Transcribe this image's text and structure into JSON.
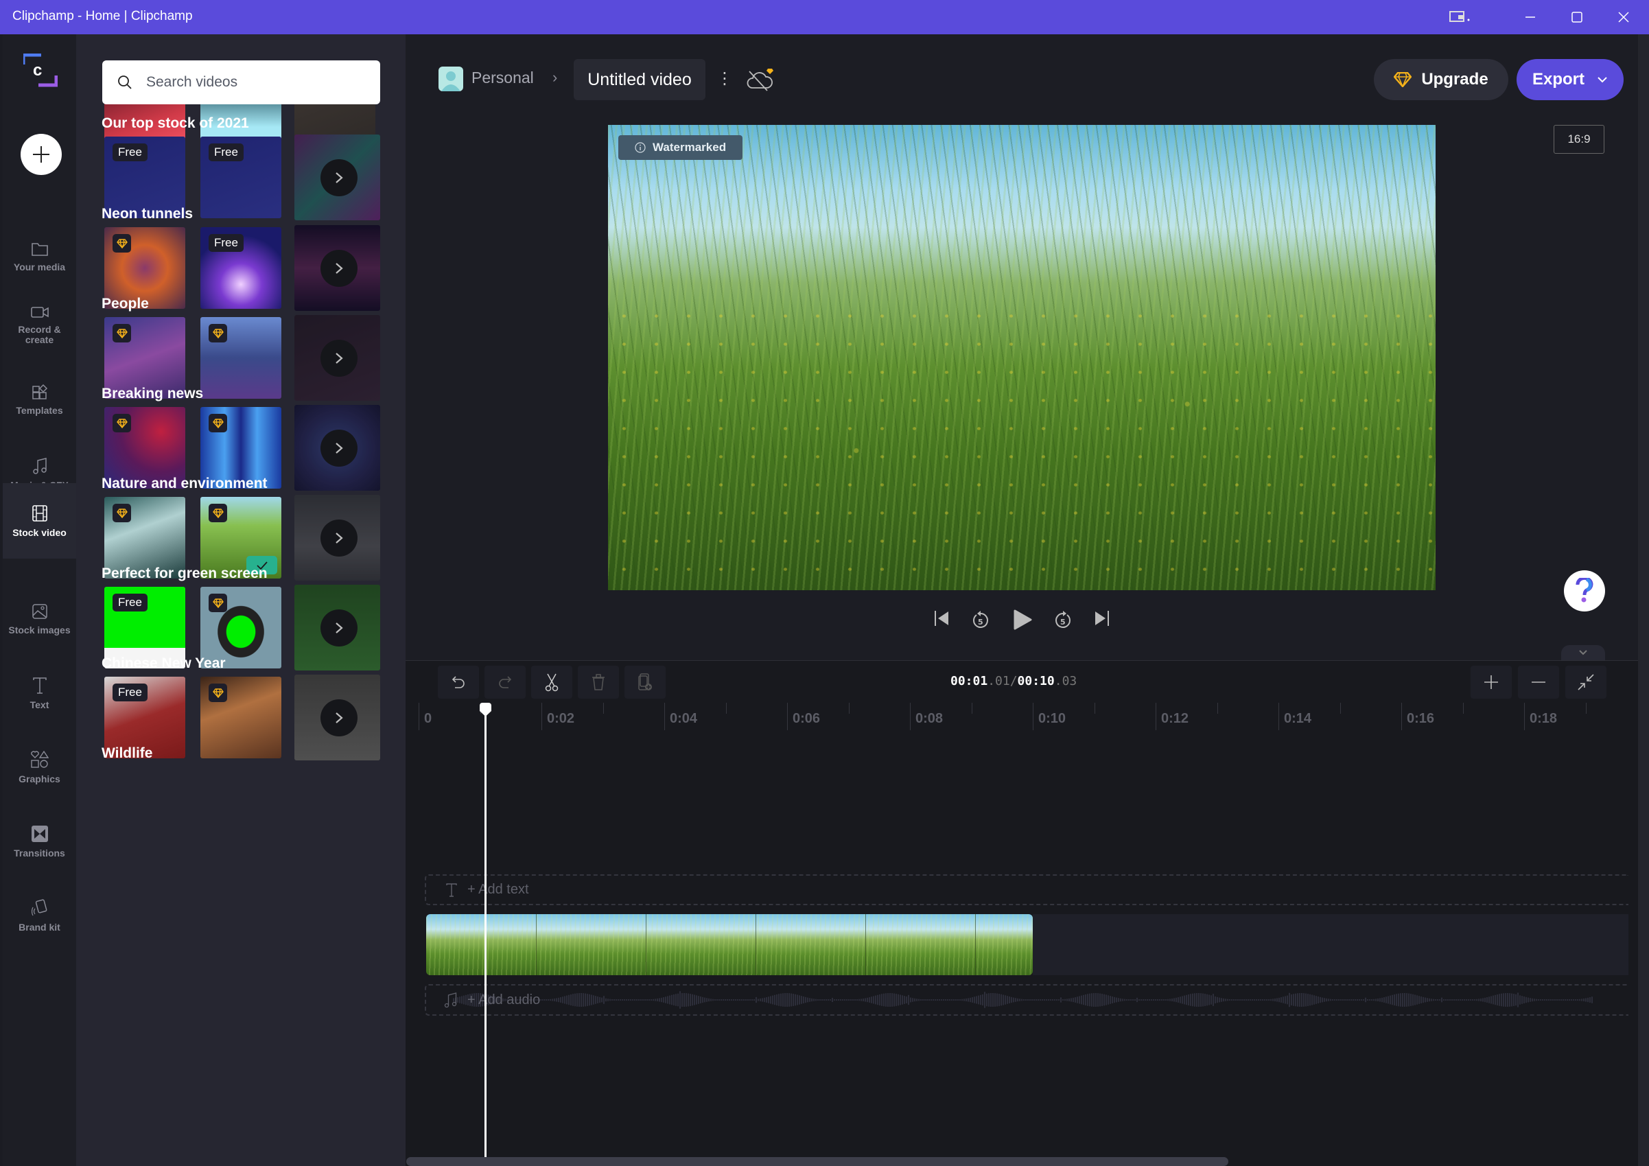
{
  "window": {
    "title": "Clipchamp - Home | Clipchamp",
    "controls": [
      "minimize",
      "maximize",
      "close"
    ]
  },
  "nav": {
    "items": [
      {
        "label": "Your media",
        "icon": "folder-icon"
      },
      {
        "label": "Record & create",
        "icon": "camera-icon"
      },
      {
        "label": "Templates",
        "icon": "templates-icon"
      },
      {
        "label": "Music & SFX",
        "icon": "music-icon"
      },
      {
        "label": "Stock video",
        "icon": "film-icon",
        "active": true
      },
      {
        "label": "Stock images",
        "icon": "image-icon"
      },
      {
        "label": "Text",
        "icon": "text-icon"
      },
      {
        "label": "Graphics",
        "icon": "shapes-icon"
      },
      {
        "label": "Transitions",
        "icon": "transitions-icon"
      },
      {
        "label": "Brand kit",
        "icon": "brand-kit-icon"
      }
    ]
  },
  "panel": {
    "search_placeholder": "Search videos",
    "free_label": "Free",
    "categories": [
      {
        "title": "Our top stock of 2021",
        "items": [
          {
            "badge": "free"
          },
          {
            "badge": "free"
          },
          {
            "badge": "more"
          }
        ]
      },
      {
        "title": "Neon tunnels",
        "items": [
          {
            "badge": "premium"
          },
          {
            "badge": "free"
          },
          {
            "badge": "more"
          }
        ]
      },
      {
        "title": "People",
        "items": [
          {
            "badge": "premium"
          },
          {
            "badge": "premium"
          },
          {
            "badge": "more"
          }
        ]
      },
      {
        "title": "Breaking news",
        "items": [
          {
            "badge": "premium"
          },
          {
            "badge": "premium"
          },
          {
            "badge": "more"
          }
        ]
      },
      {
        "title": "Nature and environment",
        "items": [
          {
            "badge": "premium"
          },
          {
            "badge": "premium",
            "added": true
          },
          {
            "badge": "more"
          }
        ]
      },
      {
        "title": "Perfect for green screen",
        "items": [
          {
            "badge": "free"
          },
          {
            "badge": "premium"
          },
          {
            "badge": "more"
          }
        ]
      },
      {
        "title": "Chinese New Year",
        "items": [
          {
            "badge": "free"
          },
          {
            "badge": "premium"
          },
          {
            "badge": "more"
          }
        ]
      },
      {
        "title": "Wildlife",
        "items": []
      }
    ]
  },
  "header": {
    "workspace": "Personal",
    "project_name": "Untitled video",
    "upgrade_label": "Upgrade",
    "export_label": "Export",
    "aspect_ratio": "16:9"
  },
  "preview": {
    "watermark_label": "Watermarked"
  },
  "timeline": {
    "current_time_main": "00:01",
    "current_time_frac": ".01",
    "separator": "/",
    "total_time_main": "00:10",
    "total_time_frac": ".03",
    "ruler_labels": [
      "0",
      "0:02",
      "0:04",
      "0:06",
      "0:08",
      "0:10",
      "0:12",
      "0:14",
      "0:16",
      "0:18"
    ],
    "add_text_label": "+ Add text",
    "add_audio_label": "+ Add audio",
    "playhead_seconds": 1.01,
    "duration_seconds": 10.03
  },
  "colors": {
    "accent": "#5a4bdb",
    "premium": "#f5b21a",
    "added": "#27b18e"
  }
}
